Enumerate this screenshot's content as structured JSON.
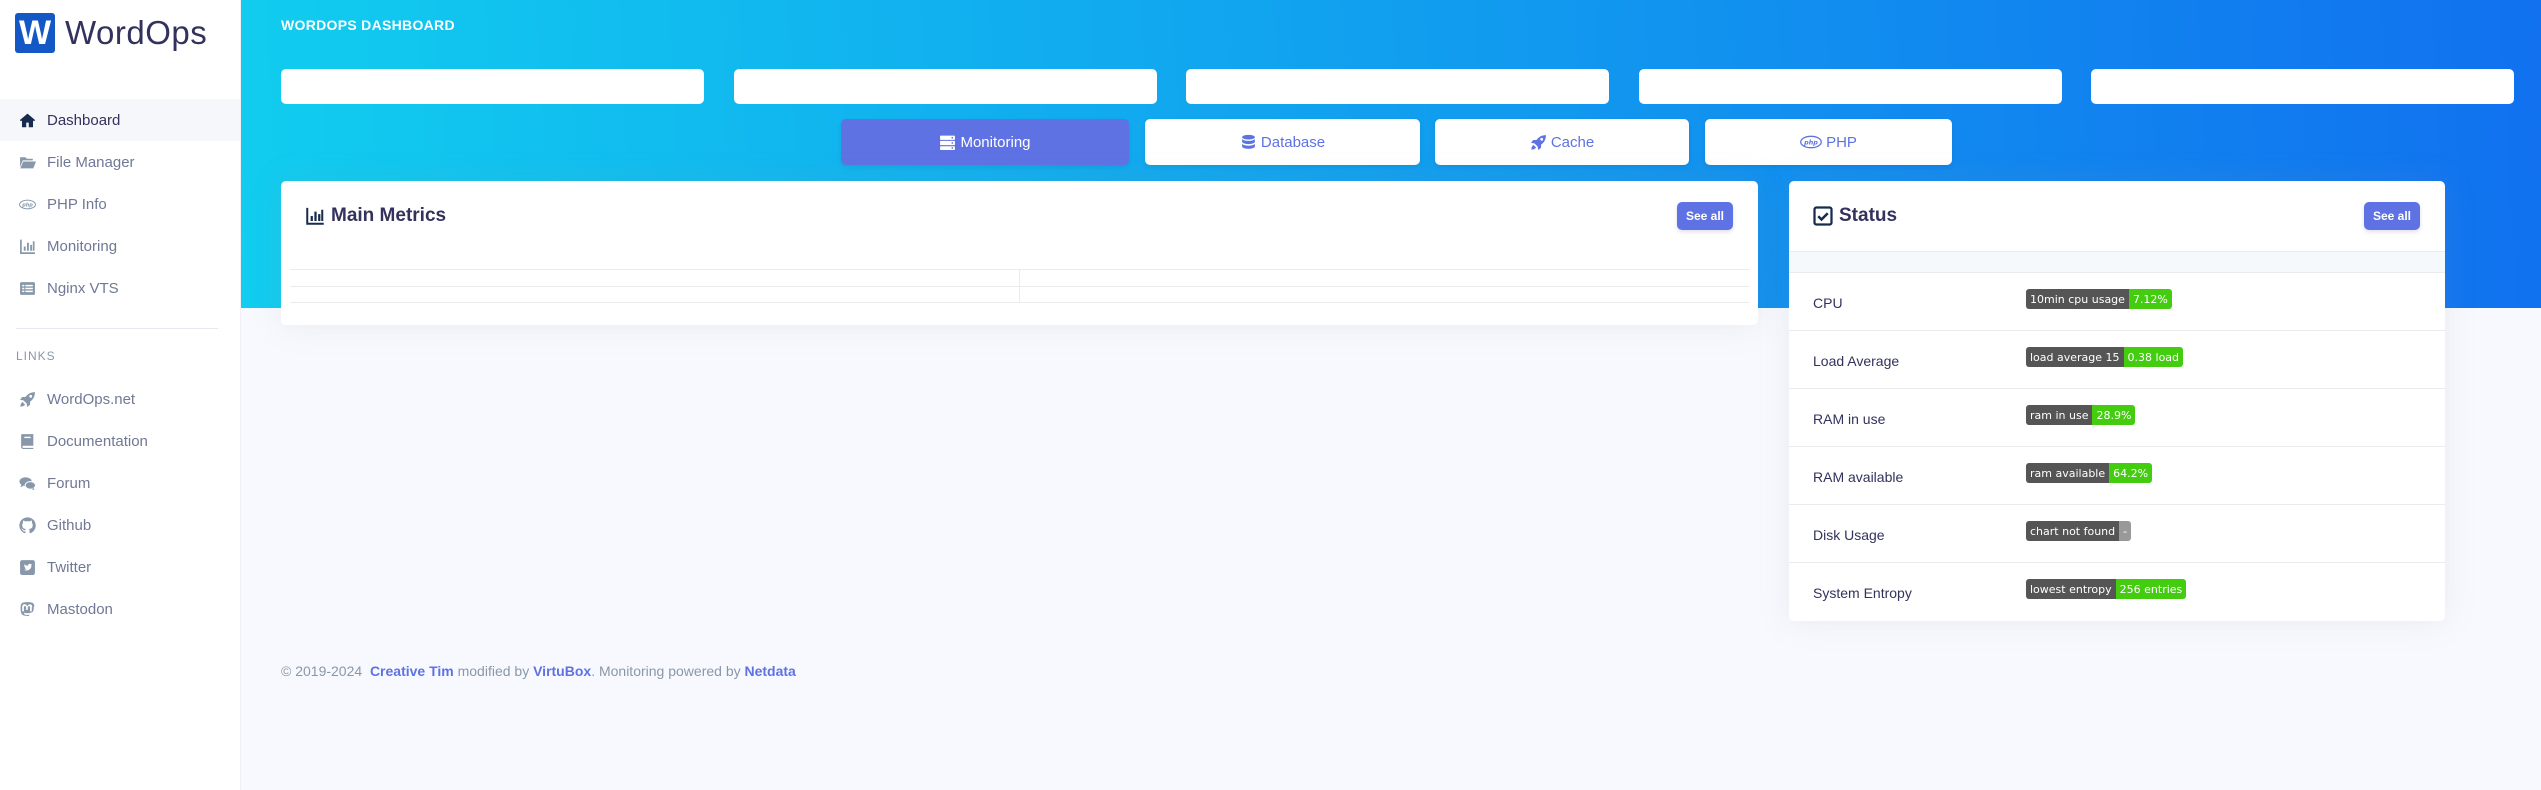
{
  "brand": {
    "logo_letter": "W",
    "name": "WordOps"
  },
  "sidebar": {
    "items": [
      {
        "label": "Dashboard",
        "icon": "home-icon",
        "active": true
      },
      {
        "label": "File Manager",
        "icon": "folder-open-icon"
      },
      {
        "label": "PHP Info",
        "icon": "php-icon"
      },
      {
        "label": "Monitoring",
        "icon": "chart-bar-icon"
      },
      {
        "label": "Nginx VTS",
        "icon": "list-icon"
      }
    ],
    "links_heading": "LINKS",
    "links": [
      {
        "label": "WordOps.net",
        "icon": "rocket-icon"
      },
      {
        "label": "Documentation",
        "icon": "book-icon"
      },
      {
        "label": "Forum",
        "icon": "comments-icon"
      },
      {
        "label": "Github",
        "icon": "github-icon"
      },
      {
        "label": "Twitter",
        "icon": "twitter-icon"
      },
      {
        "label": "Mastodon",
        "icon": "mastodon-icon"
      }
    ]
  },
  "header": {
    "title": "WORDOPS DASHBOARD"
  },
  "tabs": [
    {
      "label": "Monitoring",
      "icon": "server-icon",
      "active": true
    },
    {
      "label": "Database",
      "icon": "database-icon"
    },
    {
      "label": "Cache",
      "icon": "rocket-icon"
    },
    {
      "label": "PHP",
      "icon": "php-icon"
    }
  ],
  "metrics_card": {
    "title": "Main Metrics",
    "icon": "chart-bar-icon",
    "button": "See all"
  },
  "status_card": {
    "title": "Status",
    "icon": "check-square-icon",
    "button": "See all",
    "rows": [
      {
        "label": "CPU",
        "badge_key": "10min cpu usage",
        "badge_value": "7.12%",
        "badge_color": "#4c1"
      },
      {
        "label": "Load Average",
        "badge_key": "load average 15",
        "badge_value": "0.38 load",
        "badge_color": "#4c1"
      },
      {
        "label": "RAM in use",
        "badge_key": "ram in use",
        "badge_value": "28.9%",
        "badge_color": "#4c1"
      },
      {
        "label": "RAM available",
        "badge_key": "ram available",
        "badge_value": "64.2%",
        "badge_color": "#4c1"
      },
      {
        "label": "Disk Usage",
        "badge_key": "chart not found",
        "badge_value": "-",
        "badge_color": "#999"
      },
      {
        "label": "System Entropy",
        "badge_key": "lowest entropy",
        "badge_value": "256 entries",
        "badge_color": "#4c1"
      }
    ]
  },
  "footer": {
    "copyright": "© 2019-2024",
    "author": "Creative Tim",
    "modified_text": "modified by",
    "modifier": "VirtuBox",
    "powered_text": ". Monitoring powered by",
    "powered": "Netdata"
  }
}
